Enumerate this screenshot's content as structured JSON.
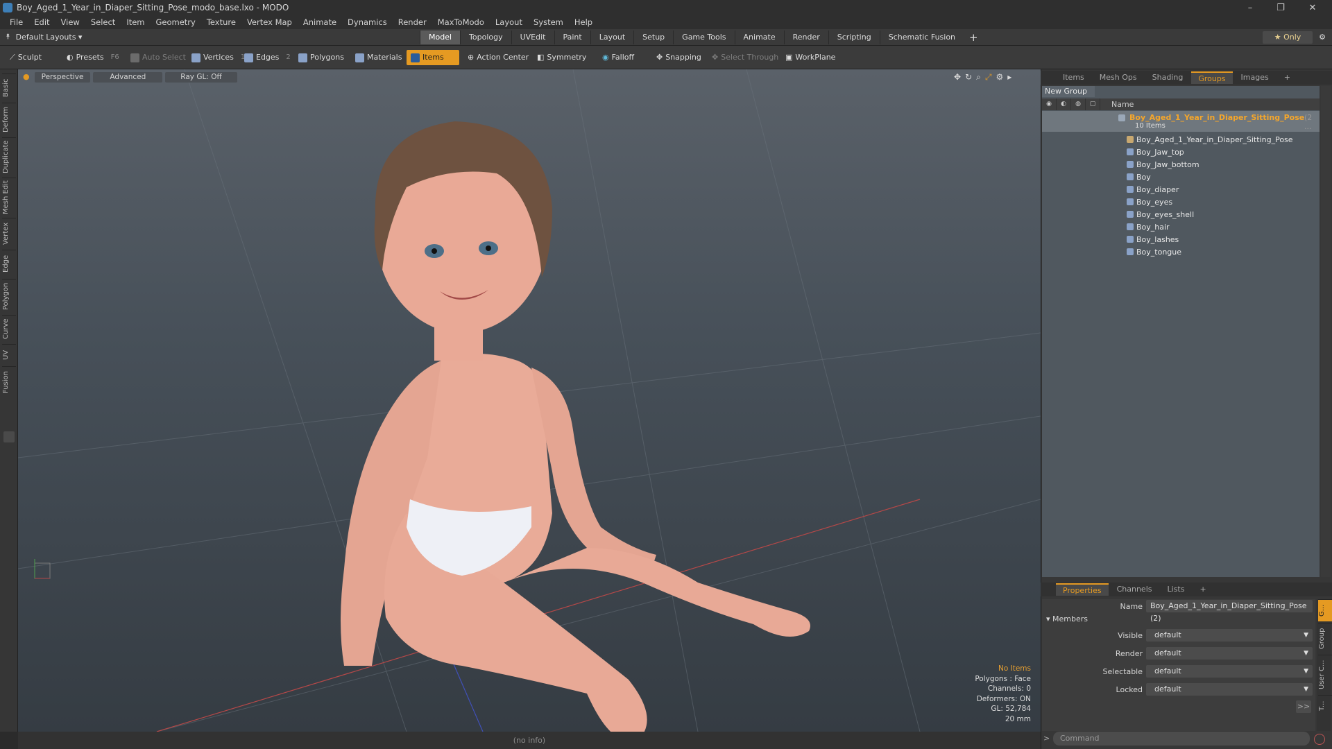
{
  "window": {
    "title": "Boy_Aged_1_Year_in_Diaper_Sitting_Pose_modo_base.lxo - MODO",
    "minimize": "–",
    "restore": "❐",
    "close": "✕"
  },
  "menu": [
    "File",
    "Edit",
    "View",
    "Select",
    "Item",
    "Geometry",
    "Texture",
    "Vertex Map",
    "Animate",
    "Dynamics",
    "Render",
    "MaxToModo",
    "Layout",
    "System",
    "Help"
  ],
  "layout_selector": "Default Layouts ▾",
  "layout_tabs": [
    "Model",
    "Topology",
    "UVEdit",
    "Paint",
    "Layout",
    "Setup",
    "Game Tools",
    "Animate",
    "Render",
    "Scripting",
    "Schematic Fusion"
  ],
  "layout_tab_active": "Model",
  "only_label": "★  Only",
  "toolbar": {
    "sculpt": "Sculpt",
    "presets": "Presets",
    "presets_shortcut": "F6",
    "auto_select": "Auto Select",
    "vertices": "Vertices",
    "vertices_count": "1",
    "edges": "Edges",
    "edges_count": "2",
    "polygons": "Polygons",
    "materials": "Materials",
    "items": "Items",
    "action_center": "Action Center",
    "symmetry": "Symmetry",
    "falloff": "Falloff",
    "snapping": "Snapping",
    "select_through": "Select Through",
    "workplane": "WorkPlane"
  },
  "left_tabs": [
    "Basic",
    "Deform",
    "Duplicate",
    "Mesh Edit",
    "Vertex",
    "Edge",
    "Polygon",
    "Curve",
    "UV",
    "Fusion"
  ],
  "viewport": {
    "perspective": "Perspective",
    "advanced": "Advanced",
    "raygl": "Ray GL: Off",
    "info": {
      "no_items": "No Items",
      "polygons": "Polygons : Face",
      "channels": "Channels: 0",
      "deformers": "Deformers: ON",
      "gl": "GL: 52,784",
      "scale": "20 mm"
    }
  },
  "status": "(no info)",
  "top_panel_tabs": [
    "Items",
    "Mesh Ops",
    "Shading",
    "Groups",
    "Images"
  ],
  "top_panel_active": "Groups",
  "new_group": "New Group",
  "groups_header": "Name",
  "groups": {
    "main": "Boy_Aged_1_Year_in_Diaper_Sitting_Pose",
    "main_suffix": "(2 ...",
    "count": "10 Items",
    "children": [
      "Boy_Aged_1_Year_in_Diaper_Sitting_Pose",
      "Boy_Jaw_top",
      "Boy_Jaw_bottom",
      "Boy",
      "Boy_diaper",
      "Boy_eyes",
      "Boy_eyes_shell",
      "Boy_hair",
      "Boy_lashes",
      "Boy_tongue"
    ]
  },
  "bottom_panel_tabs": [
    "Properties",
    "Channels",
    "Lists"
  ],
  "bottom_panel_active": "Properties",
  "properties": {
    "name_label": "Name",
    "name_value": "Boy_Aged_1_Year_in_Diaper_Sitting_Pose (2)",
    "members": "Members",
    "visible_label": "Visible",
    "visible_value": "default",
    "render_label": "Render",
    "render_value": "default",
    "selectable_label": "Selectable",
    "selectable_value": "default",
    "locked_label": "Locked",
    "locked_value": "default",
    "more": ">>"
  },
  "right_vtabs": [
    "G...",
    "Group",
    "User C...",
    "T..."
  ],
  "command_placeholder": "Command",
  "colors": {
    "accent": "#e59a22",
    "group_title": "#f4a62b"
  }
}
